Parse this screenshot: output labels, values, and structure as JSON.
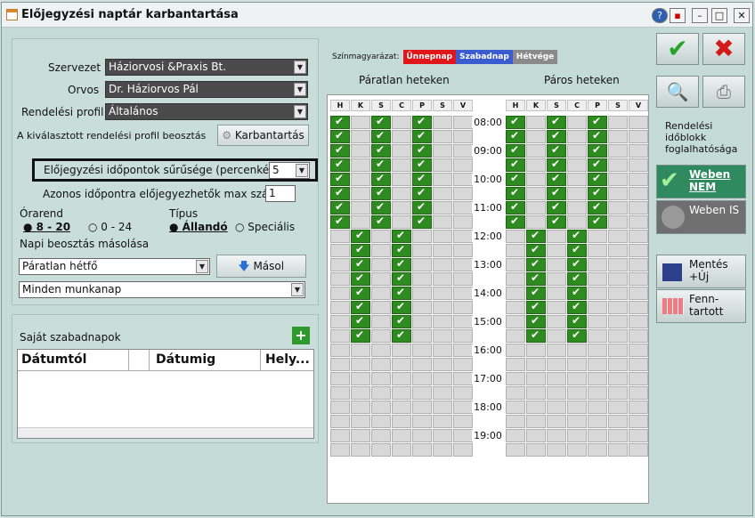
{
  "window": {
    "title": "Előjegyzési naptár karbantartása"
  },
  "form": {
    "szervezet_label": "Szervezet",
    "szervezet_value": "Háziorvosi &Praxis Bt.",
    "orvos_label": "Orvos",
    "orvos_value": "Dr. Háziorvos Pál",
    "profil_label": "Rendelési profil",
    "profil_value": "Általános",
    "beosztas_label": "A kiválasztott rendelési profil beosztás",
    "karbantartas_btn": "Karbantartás",
    "suruseg_label": "Előjegyzési időpontok sűrűsége (percenként)",
    "suruseg_value": "5",
    "maxszam_label": "Azonos időpontra előjegyezhetők max száma",
    "maxszam_value": "1",
    "orarend_label": "Órarend",
    "orarend_opt1": "8 - 20",
    "orarend_opt2": "0 - 24",
    "tipus_label": "Típus",
    "tipus_opt1": "Állandó",
    "tipus_opt2": "Speciális",
    "masolas_label": "Napi beosztás másolása",
    "masolas_from": "Páratlan hétfő",
    "masol_btn": "Másol",
    "masolas_to": "Minden munkanap"
  },
  "szabadnapok": {
    "title": "Saját szabadnapok",
    "col1": "Dátumtól",
    "col2": "Dátumig",
    "col3": "Hely..."
  },
  "legend": {
    "label": "Színmagyarázat:",
    "unnep": "Ünnepnap",
    "szabad": "Szabadnap",
    "hetvege": "Hétvége"
  },
  "calendar": {
    "odd_title": "Páratlan heteken",
    "even_title": "Páros heteken",
    "days": [
      "H",
      "K",
      "S",
      "C",
      "P",
      "S",
      "V"
    ],
    "times": [
      "08:00",
      "09:00",
      "10:00",
      "11:00",
      "12:00",
      "13:00",
      "14:00",
      "15:00",
      "16:00",
      "17:00",
      "18:00",
      "19:00"
    ],
    "odd_morning_cols": [
      0,
      2,
      4
    ],
    "odd_afternoon_cols": [
      1,
      3
    ],
    "even_morning_cols": [
      0,
      2,
      4
    ],
    "even_afternoon_cols": [
      1,
      3
    ]
  },
  "right": {
    "foglal_label": "Rendelési időblokk foglalhatósága",
    "weben_nem": "Weben NEM",
    "weben_is": "Weben IS",
    "mentes": "Mentés +Új",
    "fenntartott": "Fenn-tartott"
  },
  "colors": {
    "ok": "#2e8b1f",
    "unnep": "#e0161b",
    "szabad": "#3b5bd1",
    "hetvege": "#8a8a8a"
  }
}
